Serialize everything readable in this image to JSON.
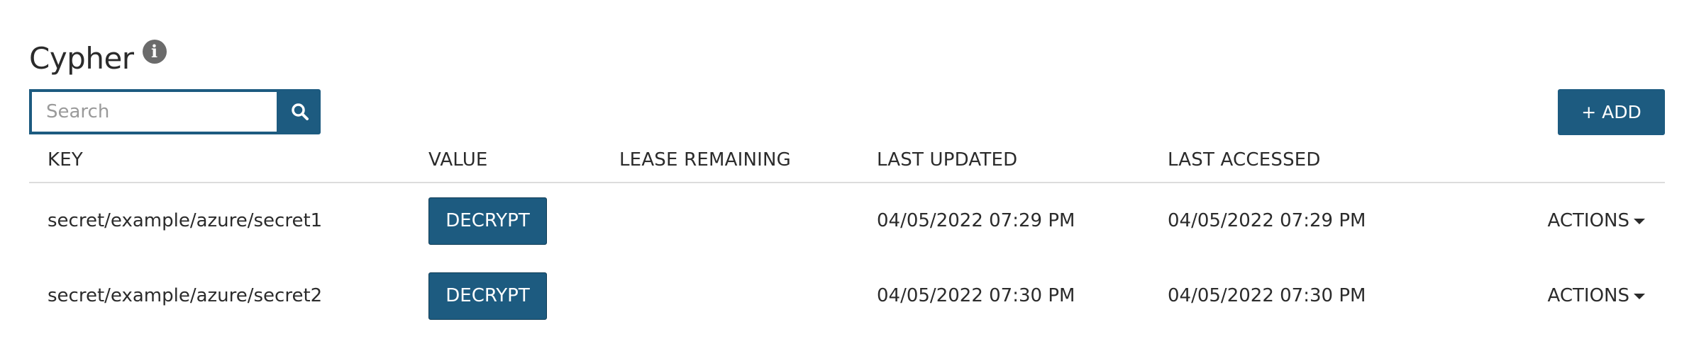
{
  "page": {
    "title": "Cypher",
    "info_icon": "info-icon"
  },
  "search": {
    "placeholder": "Search",
    "value": "",
    "button_icon": "search-icon"
  },
  "toolbar": {
    "add_label": "+ ADD"
  },
  "table": {
    "headers": {
      "key": "KEY",
      "value": "VALUE",
      "lease": "LEASE REMAINING",
      "updated": "LAST UPDATED",
      "accessed": "LAST ACCESSED"
    },
    "rows": [
      {
        "key": "secret/example/azure/secret1",
        "value_action": "DECRYPT",
        "lease": "",
        "updated": "04/05/2022 07:29 PM",
        "accessed": "04/05/2022 07:29 PM",
        "actions": "ACTIONS"
      },
      {
        "key": "secret/example/azure/secret2",
        "value_action": "DECRYPT",
        "lease": "",
        "updated": "04/05/2022 07:30 PM",
        "accessed": "04/05/2022 07:30 PM",
        "actions": "ACTIONS"
      }
    ]
  },
  "colors": {
    "primary": "#1d5b80",
    "text": "#2b2b2b",
    "divider": "#dcdcdc",
    "info_icon": "#6b6b6b"
  }
}
